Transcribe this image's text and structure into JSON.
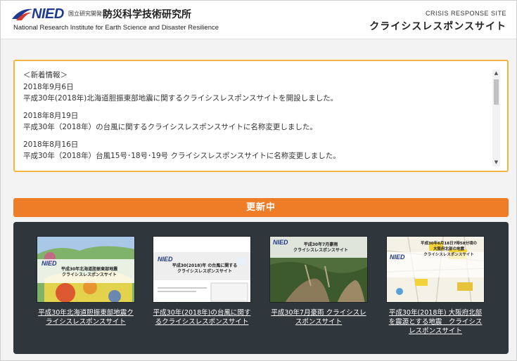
{
  "header": {
    "logo_text": "NIED",
    "logo_sub": "国立研究開発法人",
    "logo_jp": "防災科学技術研究所",
    "logo_en": "National Research Institute for Earth Science and Disaster Resilience",
    "site_en": "CRISIS RESPONSE SITE",
    "site_jp": "クライシスレスポンスサイト"
  },
  "news": {
    "heading": "＜新着情報＞",
    "items": [
      {
        "date": "2018年9月6日",
        "text": "平成30年(2018年)北海道胆振東部地震に関するクライシスレスポンスサイトを開設しました。"
      },
      {
        "date": "2018年8月19日",
        "text": "平成30年（2018年）の台風に関するクライシスレスポンスサイトに名称変更しました。"
      },
      {
        "date": "2018年8月16日",
        "text": "平成30年（2018年）台風15号･18号･19号 クライシスレスポンスサイトに名称変更しました。"
      }
    ]
  },
  "update_bar": {
    "label": "更新中"
  },
  "cards": [
    {
      "link": "平成30年北海道胆振東部地震クライシスレスポンスサイト",
      "thumb_title": "平成30年北海道胆振東部地震\nクライシスレスポンスサイト"
    },
    {
      "link": "平成30年(2018年)の台風に関するクライシスレスポンスサイト",
      "thumb_title": "平成30(2018)年 の台風に関する\nクライシスレスポンスサイト"
    },
    {
      "link": "平成30年7月豪雨 クライシスレスポンスサイト",
      "thumb_title": "平成30年7月豪雨\nクライシスレスポンスサイト"
    },
    {
      "link": "平成30年(2018年) 大阪府北部を震源とする地震　クライシスレスポンスサイト",
      "thumb_title": "平成30年6月18日7時58分頃の\n大阪府北部の地震\nクライシスレスポンスサイト"
    }
  ],
  "colors": {
    "accent_orange": "#ef7d28",
    "news_border": "#f0b640",
    "panel_bg": "#2f363c",
    "logo_blue": "#1f3a8f"
  }
}
